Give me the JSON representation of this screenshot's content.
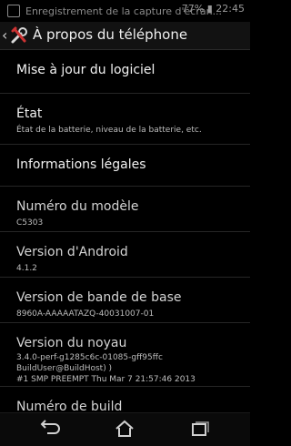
{
  "statusbar": {
    "notification": "Enregistrement de la capture d'écran...",
    "right": "77% ▮ 22:45"
  },
  "header": {
    "title": "À propos du téléphone"
  },
  "items": [
    {
      "title": "Mise à jour du logiciel"
    },
    {
      "title": "État",
      "sub": "État de la batterie, niveau de la batterie, etc."
    },
    {
      "title": "Informations légales"
    },
    {
      "title": "Numéro du modèle",
      "sub": "C5303"
    },
    {
      "title": "Version d'Android",
      "sub": "4.1.2"
    },
    {
      "title": "Version de bande de base",
      "sub": "8960A-AAAAATAZQ-40031007-01"
    },
    {
      "title": "Version du noyau",
      "sub1": "3.4.0-perf-g1285c6c-01085-gff95ffc",
      "sub2": "BuildUser@BuildHost) )",
      "sub3": "#1 SMP PREEMPT Thu Mar 7 21:57:46 2013"
    },
    {
      "title": "Numéro de build"
    }
  ],
  "navbar": {
    "back": "back-icon",
    "home": "home-icon",
    "recent": "recent-apps-icon"
  }
}
